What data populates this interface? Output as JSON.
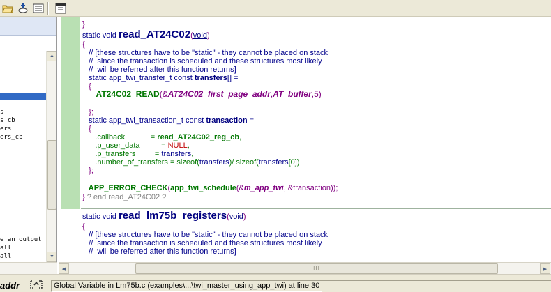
{
  "toolbar": {
    "buttons": [
      "open-folder-icon",
      "new-file-icon",
      "list-view-icon",
      "properties-icon"
    ]
  },
  "left_panel": {
    "items": [
      {
        "text": "s"
      },
      {
        "text": "s_cb"
      },
      {
        "text": "ers"
      },
      {
        "text": "ers_cb"
      },
      {
        "text": "e an output"
      },
      {
        "text": "all"
      },
      {
        "text": "all"
      }
    ]
  },
  "editor": {
    "lines": {
      "l0": "}",
      "f1_kw": "static void ",
      "f1_name": "read_AT24C02",
      "f1_open": "(",
      "f1_void": "void",
      "f1_close": ")",
      "brace_open1": "{",
      "c1": "   // [these structures have to be \"static\" - they cannot be placed on stack",
      "c2": "   //  since the transaction is scheduled and these structures most likely",
      "c3": "   //  will be referred after this function returns]",
      "t1_a": "   static app_twi_transfer_t const ",
      "t1_b": "transfers",
      "t1_c": "[] =",
      "br1": "   {",
      "rd_a": "      AT24C02_READ",
      "rd_b": "(&",
      "rd_c": "AT24C02_first_page_addr",
      "rd_d": ",",
      "rd_e": "AT_buffer",
      "rd_f": ",5)",
      "br2": "   };",
      "t2_a": "   static app_twi_transaction_t const ",
      "t2_b": "transaction",
      "t2_c": " =",
      "br3": "   {",
      "cb_a": "      .callback            = ",
      "cb_b": "read_AT24C02_reg_cb",
      "cb_c": ",",
      "ud_a": "      .p_user_data          = ",
      "ud_b": "NULL",
      "ud_c": ",",
      "pt_a": "      .p_transfers         = ",
      "pt_b": "transfers",
      "pt_c": ",",
      "nt_a": "      .number_of_transfers = sizeof(",
      "nt_b": "transfers",
      "nt_c": ")/ sizeof(",
      "nt_d": "transfers",
      "nt_e": "[0])",
      "br4": "   };",
      "ae_a": "   APP_ERROR_CHECK",
      "ae_b": "(",
      "ae_c": "app_twi_schedule",
      "ae_d": "(&",
      "ae_e": "m_app_twi",
      "ae_f": ", &transaction));",
      "end_a": "} ",
      "end_b": "? end read_AT24C02 ?",
      "f2_kw": "static void ",
      "f2_name": "read_lm75b_registers",
      "f2_open": "(",
      "f2_void": "void",
      "f2_close": ")",
      "brace_open2": "{",
      "c4": "   // [these structures have to be \"static\" - they cannot be placed on stack",
      "c5": "   //  since the transaction is scheduled and these structures most likely",
      "c6": "   //  will be referred after this function returns]"
    }
  },
  "hscroll": {
    "grip": "III"
  },
  "status": {
    "symbol": "addr",
    "icon": "symbol-type-icon",
    "text": "Global Variable in Lm75b.c (examples\\...\\twi_master_using_app_twi) at line 30"
  }
}
